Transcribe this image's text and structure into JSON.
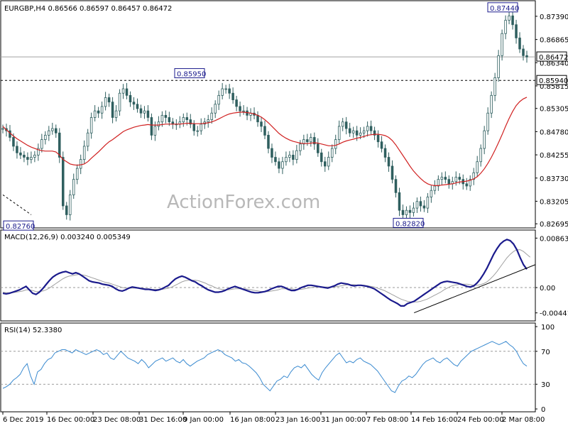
{
  "chart_data": [
    {
      "type": "candlestick",
      "title": "EURGBP,H4  0.86566 0.86597 0.86457 0.86472",
      "ylim": [
        0.8265,
        0.8763
      ],
      "yticks": [
        0.8739,
        0.86865,
        0.8634,
        0.85815,
        0.85305,
        0.8478,
        0.84255,
        0.8373,
        0.83205,
        0.82695
      ],
      "ytick_labels": [
        "0.87390",
        "0.86865",
        "0.86340",
        "0.85815",
        "0.85305",
        "0.84780",
        "0.84255",
        "0.83730",
        "0.83205",
        "0.82695"
      ],
      "current_price": 0.86472,
      "current_price_label": "0.86472",
      "horizontal_level": 0.8594,
      "horizontal_level_label": "0.85940",
      "annotations": [
        {
          "text": "0.87440",
          "value": 0.8744
        },
        {
          "text": "0.85950",
          "value": 0.8595
        },
        {
          "text": "0.82760",
          "value": 0.8276
        },
        {
          "text": "0.82820",
          "value": 0.8282
        }
      ],
      "close_values": [
        0.8485,
        0.848,
        0.8465,
        0.8445,
        0.843,
        0.8425,
        0.842,
        0.8415,
        0.842,
        0.8425,
        0.844,
        0.846,
        0.847,
        0.848,
        0.8485,
        0.8475,
        0.842,
        0.831,
        0.829,
        0.8335,
        0.837,
        0.8395,
        0.8415,
        0.8445,
        0.8475,
        0.851,
        0.8525,
        0.852,
        0.8535,
        0.8555,
        0.8545,
        0.851,
        0.8525,
        0.8565,
        0.8575,
        0.856,
        0.8545,
        0.854,
        0.853,
        0.852,
        0.8525,
        0.851,
        0.847,
        0.849,
        0.85,
        0.8515,
        0.851,
        0.85,
        0.8495,
        0.8495,
        0.85,
        0.851,
        0.8505,
        0.8495,
        0.848,
        0.848,
        0.8495,
        0.85,
        0.8505,
        0.852,
        0.854,
        0.856,
        0.8575,
        0.8575,
        0.8565,
        0.855,
        0.8535,
        0.8525,
        0.8525,
        0.8515,
        0.852,
        0.8515,
        0.85,
        0.849,
        0.847,
        0.844,
        0.842,
        0.841,
        0.8395,
        0.841,
        0.842,
        0.8425,
        0.8415,
        0.8435,
        0.845,
        0.846,
        0.8455,
        0.8465,
        0.845,
        0.843,
        0.841,
        0.84,
        0.842,
        0.844,
        0.846,
        0.849,
        0.85,
        0.8485,
        0.8475,
        0.848,
        0.847,
        0.8475,
        0.848,
        0.849,
        0.848,
        0.847,
        0.8455,
        0.844,
        0.842,
        0.84,
        0.837,
        0.834,
        0.83,
        0.829,
        0.83,
        0.8295,
        0.8305,
        0.832,
        0.831,
        0.8305,
        0.833,
        0.8345,
        0.8355,
        0.837,
        0.8375,
        0.837,
        0.836,
        0.8365,
        0.8375,
        0.837,
        0.836,
        0.8355,
        0.837,
        0.8385,
        0.841,
        0.844,
        0.848,
        0.852,
        0.856,
        0.86,
        0.865,
        0.87,
        0.873,
        0.874,
        0.872,
        0.869,
        0.8665,
        0.865,
        0.8647
      ],
      "ma_values": [
        0.849,
        0.8482,
        0.8475,
        0.8468,
        0.8462,
        0.8457,
        0.8452,
        0.8447,
        0.8443,
        0.844,
        0.8437,
        0.8435,
        0.8434,
        0.8434,
        0.8434,
        0.8432,
        0.8425,
        0.8415,
        0.841,
        0.8405,
        0.8403,
        0.8402,
        0.8403,
        0.8405,
        0.841,
        0.8418,
        0.8425,
        0.8432,
        0.844,
        0.8448,
        0.8455,
        0.846,
        0.8466,
        0.8472,
        0.8478,
        0.8482,
        0.8485,
        0.8488,
        0.849,
        0.8492,
        0.8493,
        0.8494,
        0.8493,
        0.8493,
        0.8493,
        0.8494,
        0.8495,
        0.8495,
        0.8495,
        0.8495,
        0.8495,
        0.8496,
        0.8497,
        0.8497,
        0.8496,
        0.8496,
        0.8496,
        0.8497,
        0.8498,
        0.85,
        0.8503,
        0.8507,
        0.8511,
        0.8515,
        0.8518,
        0.852,
        0.8521,
        0.8522,
        0.8522,
        0.8521,
        0.852,
        0.8518,
        0.8515,
        0.8511,
        0.8505,
        0.8498,
        0.849,
        0.8482,
        0.8474,
        0.8468,
        0.8463,
        0.8459,
        0.8456,
        0.8454,
        0.8452,
        0.8451,
        0.8451,
        0.8452,
        0.8453,
        0.8452,
        0.845,
        0.8448,
        0.8446,
        0.8446,
        0.8447,
        0.845,
        0.8454,
        0.8457,
        0.8459,
        0.8461,
        0.8463,
        0.8465,
        0.8467,
        0.847,
        0.8471,
        0.8472,
        0.8472,
        0.8471,
        0.8469,
        0.8465,
        0.8458,
        0.8448,
        0.8436,
        0.8424,
        0.8412,
        0.84,
        0.8389,
        0.838,
        0.8372,
        0.8365,
        0.836,
        0.8357,
        0.8356,
        0.8356,
        0.8357,
        0.8358,
        0.8359,
        0.836,
        0.8362,
        0.8364,
        0.8365,
        0.8366,
        0.8368,
        0.8371,
        0.8376,
        0.8384,
        0.8394,
        0.8406,
        0.842,
        0.8436,
        0.8453,
        0.8471,
        0.849,
        0.8508,
        0.8524,
        0.8537,
        0.8546,
        0.8552,
        0.8556
      ]
    },
    {
      "type": "line",
      "title": "MACD(12,26,9) 0.003240 0.005349",
      "ylim": [
        -0.0052,
        0.0093
      ],
      "ytick_labels": [
        "0.008635",
        "0.00",
        "-0.004415"
      ],
      "yticks": [
        0.008635,
        0.0,
        -0.004415
      ],
      "macd_values": [
        -0.001,
        -0.0011,
        -0.001,
        -0.0008,
        -0.0006,
        -0.0004,
        -0.0001,
        0.0002,
        -0.0004,
        -0.001,
        -0.0012,
        -0.0008,
        -0.0002,
        0.0005,
        0.0012,
        0.0018,
        0.0022,
        0.0025,
        0.0027,
        0.0028,
        0.0026,
        0.0024,
        0.0026,
        0.0024,
        0.002,
        0.0016,
        0.0012,
        0.001,
        0.0009,
        0.0008,
        0.0006,
        0.0005,
        0.0004,
        0.0002,
        -0.0002,
        -0.0005,
        -0.0006,
        -0.0004,
        -0.0001,
        0.0001,
        0.0,
        -0.0001,
        -0.0002,
        -0.0003,
        -0.0003,
        -0.0004,
        -0.0005,
        -0.0004,
        -0.0002,
        0.0001,
        0.0004,
        0.001,
        0.0015,
        0.0018,
        0.002,
        0.0018,
        0.0015,
        0.0012,
        0.001,
        0.0006,
        0.0003,
        -0.0001,
        -0.0004,
        -0.0006,
        -0.0008,
        -0.0008,
        -0.0007,
        -0.0005,
        -0.0002,
        0.0,
        0.0002,
        0.0,
        -0.0002,
        -0.0004,
        -0.0006,
        -0.0008,
        -0.0009,
        -0.0009,
        -0.0008,
        -0.0007,
        -0.0005,
        -0.0002,
        0.0,
        0.0002,
        0.0002,
        0.0,
        -0.0003,
        -0.0005,
        -0.0005,
        -0.0003,
        0.0,
        0.0002,
        0.0004,
        0.0004,
        0.0003,
        0.0002,
        0.0001,
        0.0,
        -0.0001,
        0.0001,
        0.0003,
        0.0006,
        0.0008,
        0.0007,
        0.0006,
        0.0004,
        0.0003,
        0.0004,
        0.0004,
        0.0003,
        0.0002,
        0.0,
        -0.0002,
        -0.0006,
        -0.001,
        -0.0014,
        -0.0018,
        -0.0022,
        -0.0025,
        -0.0028,
        -0.0032,
        -0.0032,
        -0.0028,
        -0.0026,
        -0.0024,
        -0.002,
        -0.0016,
        -0.0012,
        -0.0008,
        -0.0004,
        0.0,
        0.0004,
        0.0008,
        0.001,
        0.0011,
        0.001,
        0.0009,
        0.0008,
        0.0006,
        0.0004,
        0.0002,
        0.0001,
        0.0003,
        0.0008,
        0.0015,
        0.0024,
        0.0034,
        0.0046,
        0.0058,
        0.0068,
        0.0076,
        0.0081,
        0.0084,
        0.0082,
        0.0076,
        0.0066,
        0.0052,
        0.004,
        0.0032
      ],
      "signal_values": [
        -0.0008,
        -0.0009,
        -0.0009,
        -0.0009,
        -0.0008,
        -0.0007,
        -0.0006,
        -0.0004,
        -0.0004,
        -0.0005,
        -0.0007,
        -0.0007,
        -0.0006,
        -0.0004,
        -0.0001,
        0.0003,
        0.0007,
        0.0011,
        0.0015,
        0.0018,
        0.002,
        0.0021,
        0.0022,
        0.0023,
        0.0022,
        0.0021,
        0.0019,
        0.0017,
        0.0015,
        0.0013,
        0.0011,
        0.0009,
        0.0008,
        0.0006,
        0.0004,
        0.0002,
        0.0,
        -0.0001,
        -0.0001,
        -0.0001,
        -0.0001,
        -0.0001,
        -0.0001,
        -0.0002,
        -0.0002,
        -0.0003,
        -0.0003,
        -0.0003,
        -0.0003,
        -0.0002,
        -0.0001,
        0.0001,
        0.0004,
        0.0007,
        0.001,
        0.0012,
        0.0013,
        0.0013,
        0.0013,
        0.0012,
        0.001,
        0.0008,
        0.0005,
        0.0003,
        0.0,
        -0.0002,
        -0.0003,
        -0.0004,
        -0.0004,
        -0.0003,
        -0.0002,
        -0.0002,
        -0.0002,
        -0.0002,
        -0.0003,
        -0.0004,
        -0.0005,
        -0.0006,
        -0.0007,
        -0.0007,
        -0.0007,
        -0.0006,
        -0.0005,
        -0.0004,
        -0.0002,
        -0.0002,
        -0.0002,
        -0.0002,
        -0.0003,
        -0.0003,
        -0.0003,
        -0.0002,
        -0.0001,
        0.0,
        0.0001,
        0.0001,
        0.0001,
        0.0001,
        0.0001,
        0.0001,
        0.0001,
        0.0002,
        0.0003,
        0.0004,
        0.0005,
        0.0005,
        0.0005,
        0.0004,
        0.0004,
        0.0004,
        0.0003,
        0.0002,
        0.0001,
        -0.0001,
        -0.0003,
        -0.0005,
        -0.0008,
        -0.0011,
        -0.0014,
        -0.0017,
        -0.002,
        -0.0022,
        -0.0024,
        -0.0025,
        -0.0025,
        -0.0025,
        -0.0024,
        -0.0022,
        -0.002,
        -0.0017,
        -0.0014,
        -0.0011,
        -0.0008,
        -0.0004,
        -0.0001,
        0.0002,
        0.0004,
        0.0005,
        0.0006,
        0.0006,
        0.0006,
        0.0005,
        0.0004,
        0.0004,
        0.0005,
        0.0007,
        0.001,
        0.0015,
        0.0021,
        0.0028,
        0.0036,
        0.0044,
        0.0052,
        0.0058,
        0.0063,
        0.0066,
        0.0066,
        0.0063,
        0.0058,
        0.0053
      ]
    },
    {
      "type": "line",
      "title": "RSI(14) 52.3380",
      "ylim": [
        0,
        100
      ],
      "ytick_labels": [
        "100",
        "70",
        "30",
        "0"
      ],
      "yticks": [
        100,
        70,
        30,
        0
      ],
      "rsi_values": [
        25,
        27,
        30,
        35,
        38,
        42,
        50,
        55,
        40,
        30,
        45,
        48,
        55,
        60,
        62,
        68,
        70,
        72,
        72,
        70,
        68,
        72,
        70,
        68,
        66,
        68,
        70,
        72,
        70,
        66,
        68,
        62,
        60,
        65,
        70,
        66,
        62,
        60,
        58,
        55,
        60,
        56,
        50,
        54,
        58,
        60,
        62,
        58,
        60,
        62,
        58,
        56,
        60,
        55,
        52,
        55,
        58,
        60,
        62,
        66,
        68,
        70,
        72,
        70,
        66,
        64,
        62,
        58,
        60,
        56,
        55,
        52,
        48,
        44,
        38,
        30,
        26,
        22,
        28,
        34,
        36,
        40,
        38,
        45,
        50,
        52,
        50,
        54,
        48,
        42,
        38,
        35,
        44,
        50,
        55,
        60,
        65,
        68,
        62,
        56,
        58,
        56,
        60,
        62,
        58,
        56,
        54,
        50,
        46,
        40,
        34,
        28,
        22,
        20,
        28,
        34,
        36,
        40,
        38,
        42,
        48,
        54,
        58,
        60,
        62,
        58,
        56,
        60,
        62,
        58,
        54,
        52,
        58,
        62,
        66,
        70,
        72,
        74,
        76,
        78,
        80,
        82,
        80,
        78,
        80,
        82,
        78,
        75,
        70,
        62,
        55,
        52
      ]
    }
  ],
  "watermark": "ActionForex.com",
  "date_labels": [
    "6 Dec 2019",
    "16 Dec 00:00",
    "23 Dec 08:00",
    "31 Dec 16:00",
    "9 Jan 00:00",
    "16 Jan 08:00",
    "23 Jan 16:00",
    "31 Jan 00:00",
    "7 Feb 08:00",
    "14 Feb 16:00",
    "24 Feb 00:00",
    "2 Mar 08:00"
  ],
  "colors": {
    "candle": "#2f5f5f",
    "ma": "#d02020",
    "macd": "#1a1a8c",
    "signal": "#a0a0a0",
    "rsi": "#3a8ad0",
    "trendline": "#000000",
    "grid_dash": "#9a9a9a"
  }
}
